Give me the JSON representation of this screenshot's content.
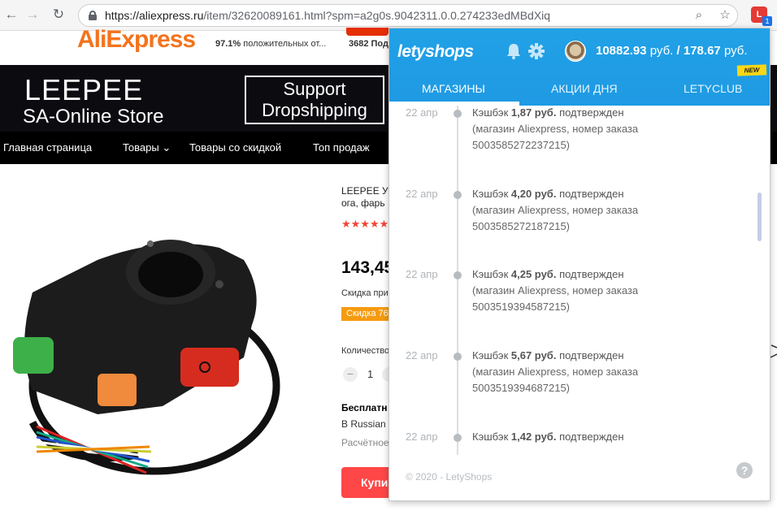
{
  "browser": {
    "url_host": "https://aliexpress.ru",
    "url_path": "/item/32620089161.html?spm=a2g0s.9042311.0.0.274233edMBdXiq",
    "ext_badge": "1"
  },
  "ali": {
    "logo": "AliExpress",
    "rating_percent": "97.1%",
    "rating_text": "положительных от...",
    "followers": "3682 Под",
    "store_name": "LEEPEE",
    "store_sub": "SA-Online Store",
    "support_line1": "Support",
    "support_line2": "Dropshipping",
    "nav": [
      "Главная страница",
      "Товары",
      "Товары со скидкой",
      "Топ продаж"
    ],
    "product_title_1": "LEEPEE Ун",
    "product_title_2": "ога, фарь",
    "stars": "★★★★★",
    "price": "143,45",
    "discount_label": "Скидка при",
    "discount_badge": "Скидка 76",
    "qty_label": "Количество",
    "qty_value": "1",
    "qty_minus": "−",
    "ship_title": "Бесплатн",
    "ship_to": "В Russian",
    "ship_est": "Расчётное",
    "buy_label": "Купи"
  },
  "lety": {
    "logo": "letyshops",
    "balance_rub": "10882.93",
    "balance_rub_unit": "руб.",
    "balance_sep": "/",
    "balance_pending": "178.67",
    "balance_pending_unit": "руб.",
    "tabs": [
      "МАГАЗИНЫ",
      "АКЦИИ ДНЯ",
      "LETYCLUB"
    ],
    "new_badge": "NEW",
    "entries": [
      {
        "date": "22 апр",
        "prefix": "Кэшбэк",
        "amount": "1,87 руб.",
        "status": "подтвержден",
        "line2": "(магазин Aliexpress, номер заказа",
        "line3": "5003585272237215)"
      },
      {
        "date": "22 апр",
        "prefix": "Кэшбэк",
        "amount": "4,20 руб.",
        "status": "подтвержден",
        "line2": "(магазин Aliexpress, номер заказа",
        "line3": "5003585272187215)"
      },
      {
        "date": "22 апр",
        "prefix": "Кэшбэк",
        "amount": "4,25 руб.",
        "status": "подтвержден",
        "line2": "(магазин Aliexpress, номер заказа",
        "line3": "5003519394587215)"
      },
      {
        "date": "22 апр",
        "prefix": "Кэшбэк",
        "amount": "5,67 руб.",
        "status": "подтвержден",
        "line2": "(магазин Aliexpress, номер заказа",
        "line3": "5003519394687215)"
      },
      {
        "date": "22 апр",
        "prefix": "Кэшбэк",
        "amount": "1,42 руб.",
        "status": "подтвержден",
        "line2": "",
        "line3": ""
      }
    ],
    "footer": "© 2020 - LetyShops",
    "help": "?"
  },
  "colors": {
    "lety_blue": "#1f9ae4",
    "ali_orange": "#f4731c",
    "ali_red": "#ff4747"
  }
}
